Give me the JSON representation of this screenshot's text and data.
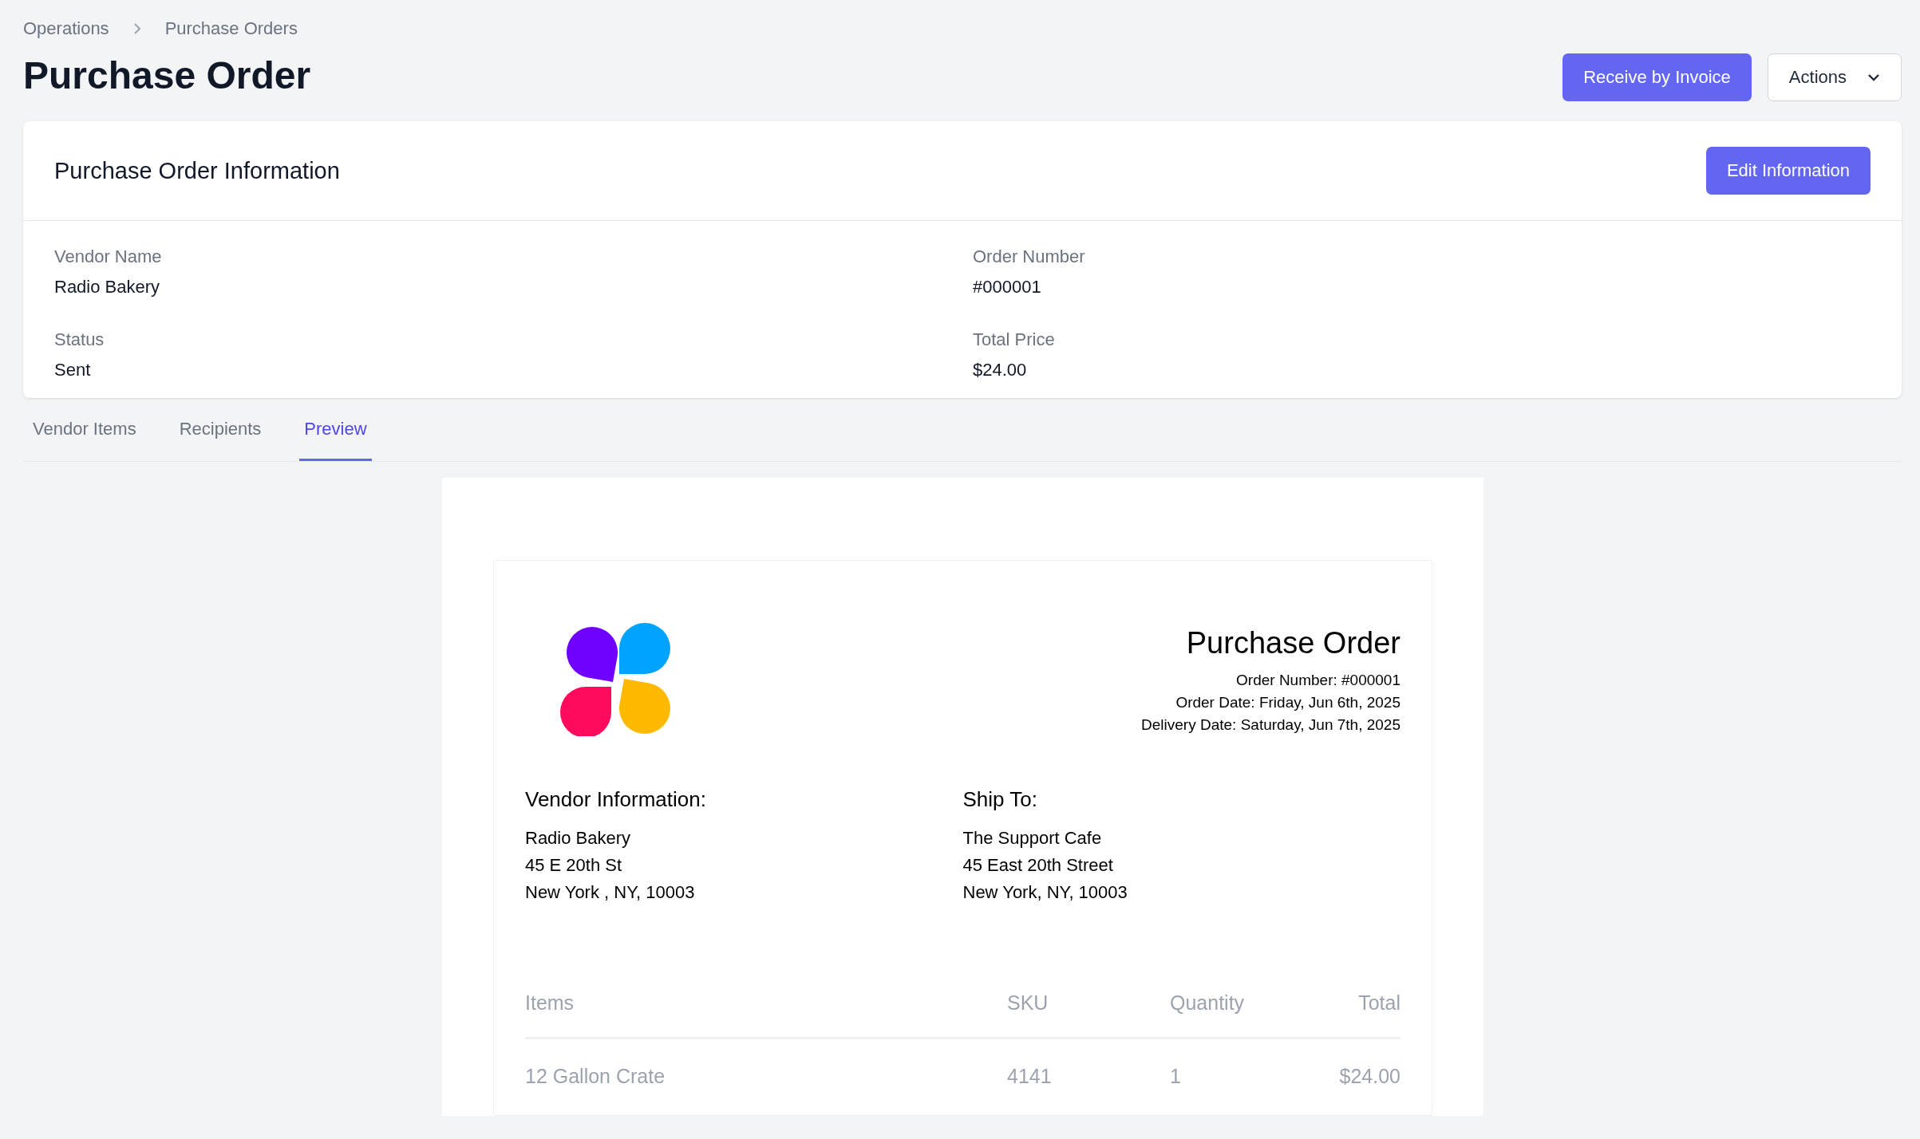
{
  "breadcrumb": [
    "Operations",
    "Purchase Orders"
  ],
  "title": "Purchase Order",
  "header_buttons": [
    {
      "label": "Receive by Invoice",
      "kind": "primary"
    },
    {
      "label": "Actions",
      "kind": "dropdown"
    }
  ],
  "info_card": {
    "title": "Purchase Order Information",
    "button": "Edit Information",
    "fields": [
      {
        "label": "Vendor Name",
        "value": "Radio Bakery"
      },
      {
        "label": "Order Number",
        "value": "#000001"
      },
      {
        "label": "Status",
        "value": "Sent"
      },
      {
        "label": "Total Price",
        "value": "$24.00"
      }
    ]
  },
  "tabs": [
    {
      "label": "Vendor Items",
      "selected": false
    },
    {
      "label": "Recipients",
      "selected": false
    },
    {
      "label": "Preview",
      "selected": true
    }
  ],
  "preview": {
    "title": "Purchase Order",
    "meta": [
      "Order Number: #000001",
      "Order Date: Friday, Jun 6th, 2025",
      "Delivery Date: Saturday, Jun 7th, 2025"
    ],
    "vendor": {
      "heading": "Vendor Information:",
      "lines": [
        "Radio Bakery",
        "45 E 20th St",
        "New York , NY, 10003"
      ]
    },
    "ship_to": {
      "heading": "Ship To:",
      "lines": [
        "The Support Cafe",
        "45 East 20th Street",
        "New York, NY, 10003"
      ]
    },
    "table": {
      "columns": [
        "Items",
        "SKU",
        "Quantity",
        "Total"
      ],
      "rows": [
        [
          "12 Gallon Crate",
          "4141",
          "1",
          "$24.00"
        ]
      ]
    }
  }
}
